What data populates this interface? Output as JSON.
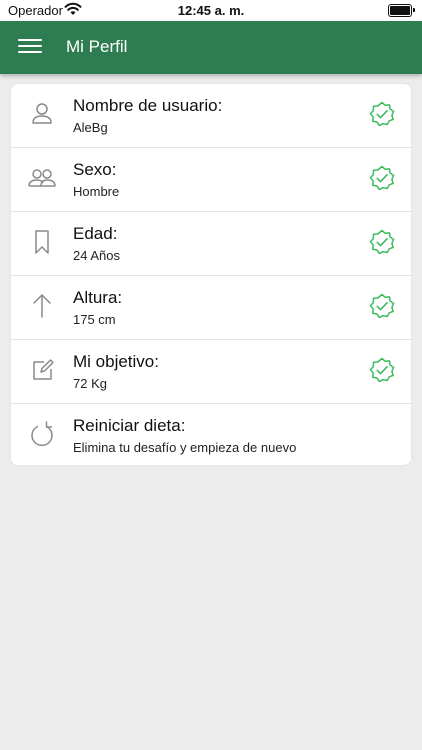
{
  "status_bar": {
    "carrier": "Operador",
    "time": "12:45 a. m."
  },
  "header": {
    "title": "Mi Perfil"
  },
  "colors": {
    "brand_green": "#2e7d50",
    "check_green": "#3dbb5c",
    "icon_gray": "#8a8a8a"
  },
  "profile": {
    "items": [
      {
        "title": "Nombre de usuario:",
        "value": "AleBg",
        "icon": "user-icon",
        "verified": true
      },
      {
        "title": "Sexo:",
        "value": "Hombre",
        "icon": "users-icon",
        "verified": true
      },
      {
        "title": "Edad:",
        "value": "24 Años",
        "icon": "bookmark-icon",
        "verified": true
      },
      {
        "title": "Altura:",
        "value": "175 cm",
        "icon": "arrow-up-icon",
        "verified": true
      },
      {
        "title": "Mi objetivo:",
        "value": "72 Kg",
        "icon": "edit-icon",
        "verified": true
      },
      {
        "title": "Reiniciar dieta:",
        "value": "Elimina tu desafío y empieza de nuevo",
        "icon": "refresh-icon",
        "verified": false
      }
    ]
  }
}
